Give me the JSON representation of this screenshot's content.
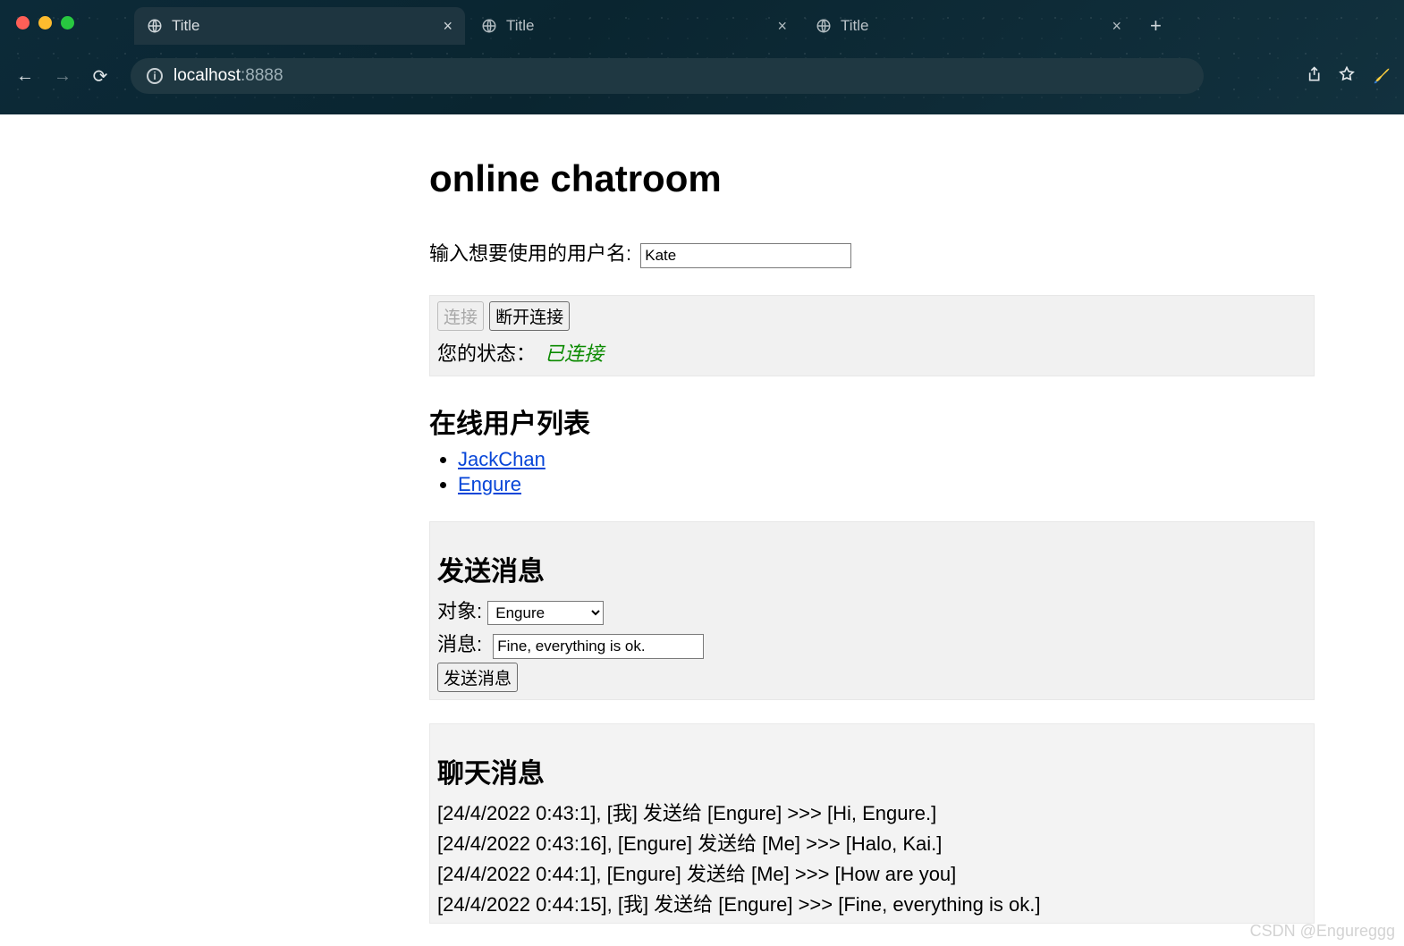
{
  "browser": {
    "tabs": [
      {
        "label": "Title",
        "active": true
      },
      {
        "label": "Title",
        "active": false
      },
      {
        "label": "Title",
        "active": false
      }
    ],
    "address": {
      "host": "localhost",
      "port": ":8888"
    }
  },
  "page": {
    "title": "online chatroom",
    "username_label": "输入想要使用的用户名:",
    "username_value": "Kate",
    "connect_label": "连接",
    "disconnect_label": "断开连接",
    "status_label": "您的状态：",
    "status_value": "已连接",
    "online_users_heading": "在线用户列表",
    "users": [
      "JackChan",
      "Engure"
    ],
    "send_heading": "发送消息",
    "target_label": "对象:",
    "target_value": "Engure",
    "message_label": "消息:",
    "message_value": "Fine, everything is ok.",
    "send_button_label": "发送消息",
    "chat_heading": "聊天消息",
    "messages": [
      "[24/4/2022 0:43:1], [我] 发送给 [Engure] >>> [Hi, Engure.]",
      "[24/4/2022 0:43:16], [Engure] 发送给 [Me] >>> [Halo, Kai.]",
      "[24/4/2022 0:44:1], [Engure] 发送给 [Me] >>> [How are you]",
      "[24/4/2022 0:44:15], [我] 发送给 [Engure] >>> [Fine, everything is ok.]"
    ]
  },
  "watermark": "CSDN @Engureggg"
}
